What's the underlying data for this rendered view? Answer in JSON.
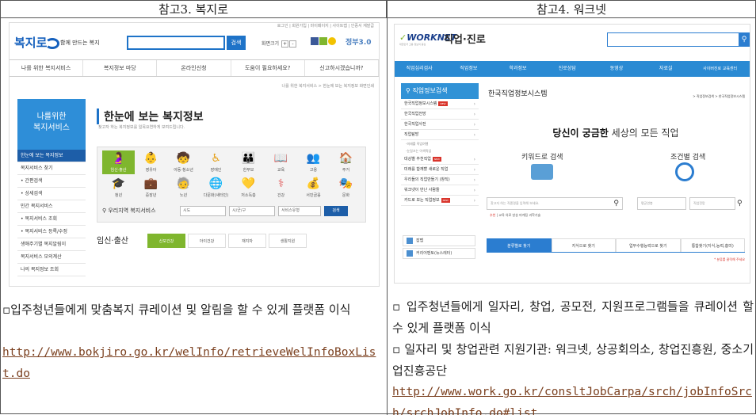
{
  "headers": {
    "left": "참고3. 복지로",
    "right": "참고4. 워크넷"
  },
  "bokjiro": {
    "top_links": "로그인 | 회원가입 | 마이페이지 | 사이트맵 | 인증서 재발급",
    "logo": "복지로",
    "logo_sub": "함께 만드는 복지",
    "search_button": "검색",
    "zoom_label": "화면크기",
    "zoom_plus": "+",
    "zoom_minus": "-",
    "gov_badge": "정부3.0",
    "gnb": [
      "나를 위한 복지서비스",
      "복지정보 마당",
      "온라인신청",
      "도움이 필요하세요?",
      "신고하시겠습니까?"
    ],
    "breadcrumb": "나를 위한 복지서비스 > 한눈에 보는 복지정보   화면인쇄",
    "lnb_head": [
      "나를위한",
      "복지서비스"
    ],
    "lnb": [
      "한눈에 보는 복지정보",
      "복지서비스 찾기",
      "• 간편검색",
      "• 상세검색",
      "민간 복지서비스",
      "• 복지서비스 조회",
      "• 복지서비스 등록/수정",
      "생애주기별 복지알림이",
      "복지서비스 모의계산",
      "나의 복지정보 조회"
    ],
    "title": "한눈에 보는 복지정보",
    "subtitle": "찾고자 하는 복지정보를 일목요연하게 보여드립니다.",
    "icons": [
      {
        "label": "임신·출산",
        "glyph": "🤰",
        "color": "#ffffff"
      },
      {
        "label": "영유아",
        "glyph": "👶",
        "color": "#7fb62e"
      },
      {
        "label": "아동·청소년",
        "glyph": "🧒",
        "color": "#7fb62e"
      },
      {
        "label": "장애인",
        "glyph": "♿",
        "color": "#e6a21b"
      },
      {
        "label": "한부모",
        "glyph": "👪",
        "color": "#e6a21b"
      },
      {
        "label": "교육",
        "glyph": "📖",
        "color": "#e05a5a"
      },
      {
        "label": "고용",
        "glyph": "👥",
        "color": "#e05a5a"
      },
      {
        "label": "주거",
        "glyph": "🏠",
        "color": "#e05a5a"
      },
      {
        "label": "청년",
        "glyph": "🎓",
        "color": "#7fb62e"
      },
      {
        "label": "중장년",
        "glyph": "💼",
        "color": "#7fb62e"
      },
      {
        "label": "노년",
        "glyph": "🧓",
        "color": "#7fb62e"
      },
      {
        "label": "다문화(새터민)",
        "glyph": "🌐",
        "color": "#e6a21b"
      },
      {
        "label": "저소득층",
        "glyph": "💛",
        "color": "#e6a21b"
      },
      {
        "label": "건강",
        "glyph": "⚕",
        "color": "#e05a5a"
      },
      {
        "label": "서민금융",
        "glyph": "💰",
        "color": "#e05a5a"
      },
      {
        "label": "문화",
        "glyph": "🎭",
        "color": "#e05a5a"
      }
    ],
    "filter_label": "우리지역 복지서비스",
    "filter_selects": [
      "시도",
      "시/군/구",
      "서비스유형"
    ],
    "filter_button": "검색",
    "life_title": "임신·출산",
    "life_tabs": [
      "산모건강",
      "아이건강",
      "재지자",
      "생활지원"
    ]
  },
  "worknet": {
    "logo": "WORKNET",
    "logo_title": "직업·진로",
    "logo_sub": "대한민국 고용 정보의 중심",
    "search_button": "🔍",
    "gnb": [
      "직업심리검사",
      "직업정보",
      "학과정보",
      "진로상담",
      "동영상",
      "자료실",
      "사이버진로 교육센터"
    ],
    "side_head": "직업정보검색",
    "side_items": [
      "한국직업정보시스템",
      "한국직업전망",
      "한국직업사전",
      "직업탐방"
    ],
    "side_small": [
      "-미래를 직업여행",
      "-눈길끄는 이색직업"
    ],
    "side_items2": [
      "대상별 추천직업",
      "미래를 함께할 새로운 직업",
      "우리들의 직업만들기 (창직)",
      "워크넷이 만난 사람들",
      "카드로 보는 직업정보"
    ],
    "side_badge": "NEW",
    "extra": [
      "잡맵",
      "커리어맨토(뉴스레터)"
    ],
    "main_title": "한국직업정보시스템",
    "breadcrumb": "> 직업정보검색 > 한국직업정보시스템",
    "hero_pre": "당신이 궁금한",
    "hero_post": "세상의 모든 직업",
    "kw_label": "키워드로 검색",
    "cond_label": "조건별 검색",
    "kw_placeholder": "찾고자 하는 직종명을 입력해 보세요.",
    "sel1": "평균연봉",
    "sel2": "직업전망",
    "rec_label": "추천",
    "rec_words": "교육  의료  방송  마케팅  과학기술",
    "tabs": [
      "분류별로 찾기",
      "지식으로 찾기",
      "업무수행능력으로 찾기",
      "통합찾기(지식,능력,흥미)"
    ],
    "note": "* 분류를 클릭해 주세요"
  },
  "left_text": {
    "para": "▫입주청년들에게 맞춤복지 큐레이션 및 알림을 할 수 있게 플랫폼 이식",
    "link": "http://www.bokjiro.go.kr/welInfo/retrieveWelInfoBoxList.do"
  },
  "right_text": {
    "para1": "▫ 입주청년들에게 일자리, 창업, 공모전, 지원프로그램들을 큐레이션 할 수 있게 플랫폼 이식",
    "para2": "▫ 일자리 및 창업관련 지원기관: 워크넷, 상공회의소, 창업진흥원, 중소기업진흥공단",
    "link": "http://www.work.go.kr/consltJobCarpa/srch/jobInfoSrch/srchJobInfo.do#list"
  }
}
